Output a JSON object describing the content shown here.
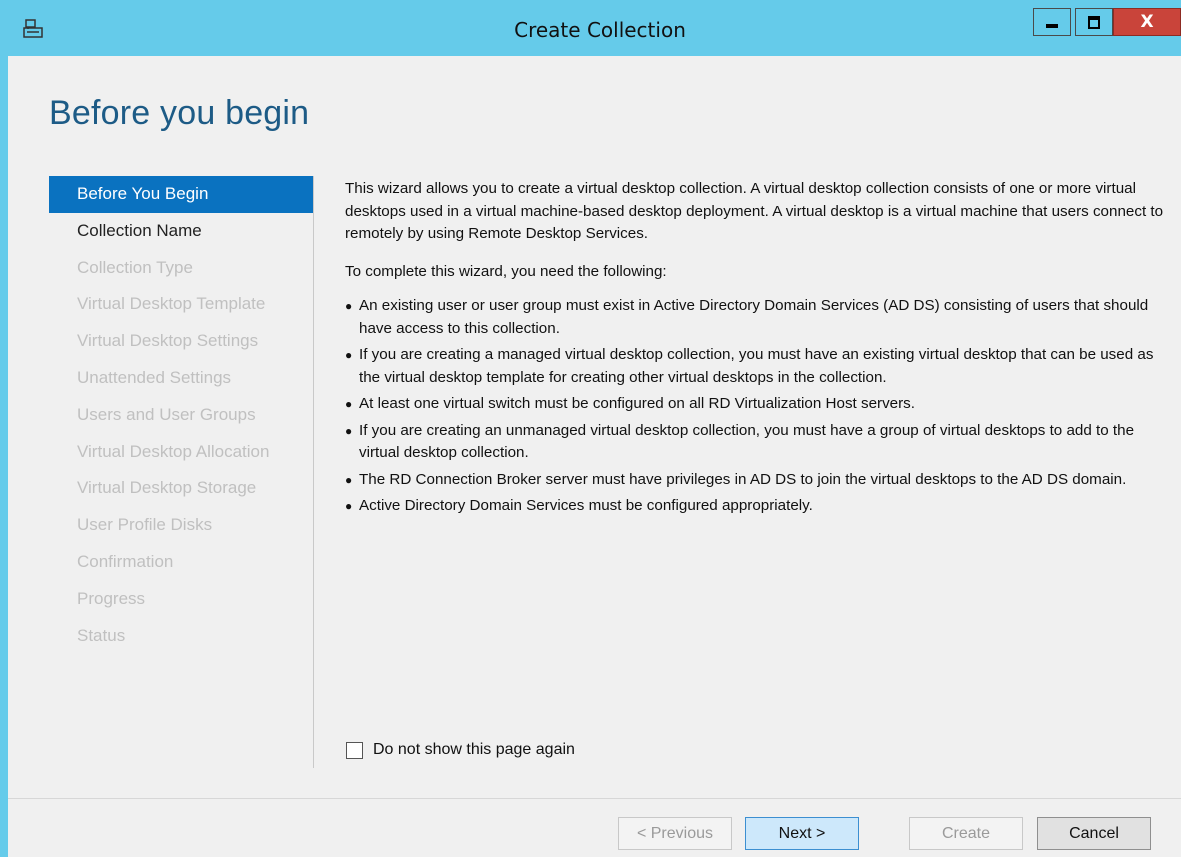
{
  "window": {
    "title": "Create Collection",
    "controls": {
      "minimize": "minimize",
      "maximize": "maximize",
      "close": "X"
    }
  },
  "page": {
    "heading": "Before you begin"
  },
  "nav": {
    "items": [
      {
        "label": "Before You Begin",
        "state": "active"
      },
      {
        "label": "Collection Name",
        "state": "enabled"
      },
      {
        "label": "Collection Type",
        "state": "disabled"
      },
      {
        "label": "Virtual Desktop Template",
        "state": "disabled"
      },
      {
        "label": "Virtual Desktop Settings",
        "state": "disabled"
      },
      {
        "label": "Unattended Settings",
        "state": "disabled"
      },
      {
        "label": "Users and User Groups",
        "state": "disabled"
      },
      {
        "label": "Virtual Desktop Allocation",
        "state": "disabled"
      },
      {
        "label": "Virtual Desktop Storage",
        "state": "disabled"
      },
      {
        "label": "User Profile Disks",
        "state": "disabled"
      },
      {
        "label": "Confirmation",
        "state": "disabled"
      },
      {
        "label": "Progress",
        "state": "disabled"
      },
      {
        "label": "Status",
        "state": "disabled"
      }
    ]
  },
  "content": {
    "intro": "This wizard allows you to create a virtual desktop collection. A virtual desktop collection consists of one or more virtual desktops used in a virtual machine-based desktop deployment. A virtual desktop is a virtual machine that users connect to remotely by using Remote Desktop Services.",
    "requirements_lead": "To complete this wizard, you need the following:",
    "requirements": [
      "An existing user or user group must exist in Active Directory Domain Services (AD DS) consisting of users that should have access to this collection.",
      "If you are creating a managed virtual desktop collection, you must have an existing virtual desktop that can be used as the virtual desktop template for creating other virtual desktops in the collection.",
      "At least one virtual switch must be configured on all RD Virtualization Host servers.",
      "If you are creating an unmanaged virtual desktop collection, you must have a group of virtual desktops to add to the virtual desktop collection.",
      "The RD Connection Broker server must have privileges in AD DS to join the virtual desktops to the AD DS domain.",
      "Active Directory Domain Services must be configured appropriately."
    ]
  },
  "options": {
    "dont_show_label": "Do not show this page again",
    "dont_show_checked": false
  },
  "footer": {
    "previous_label": "< Previous",
    "next_label": "Next >",
    "create_label": "Create",
    "cancel_label": "Cancel"
  },
  "colors": {
    "titlebar": "#65cbea",
    "nav_active": "#0a72c0",
    "heading": "#1d5b86",
    "close_button": "#c9443a"
  }
}
